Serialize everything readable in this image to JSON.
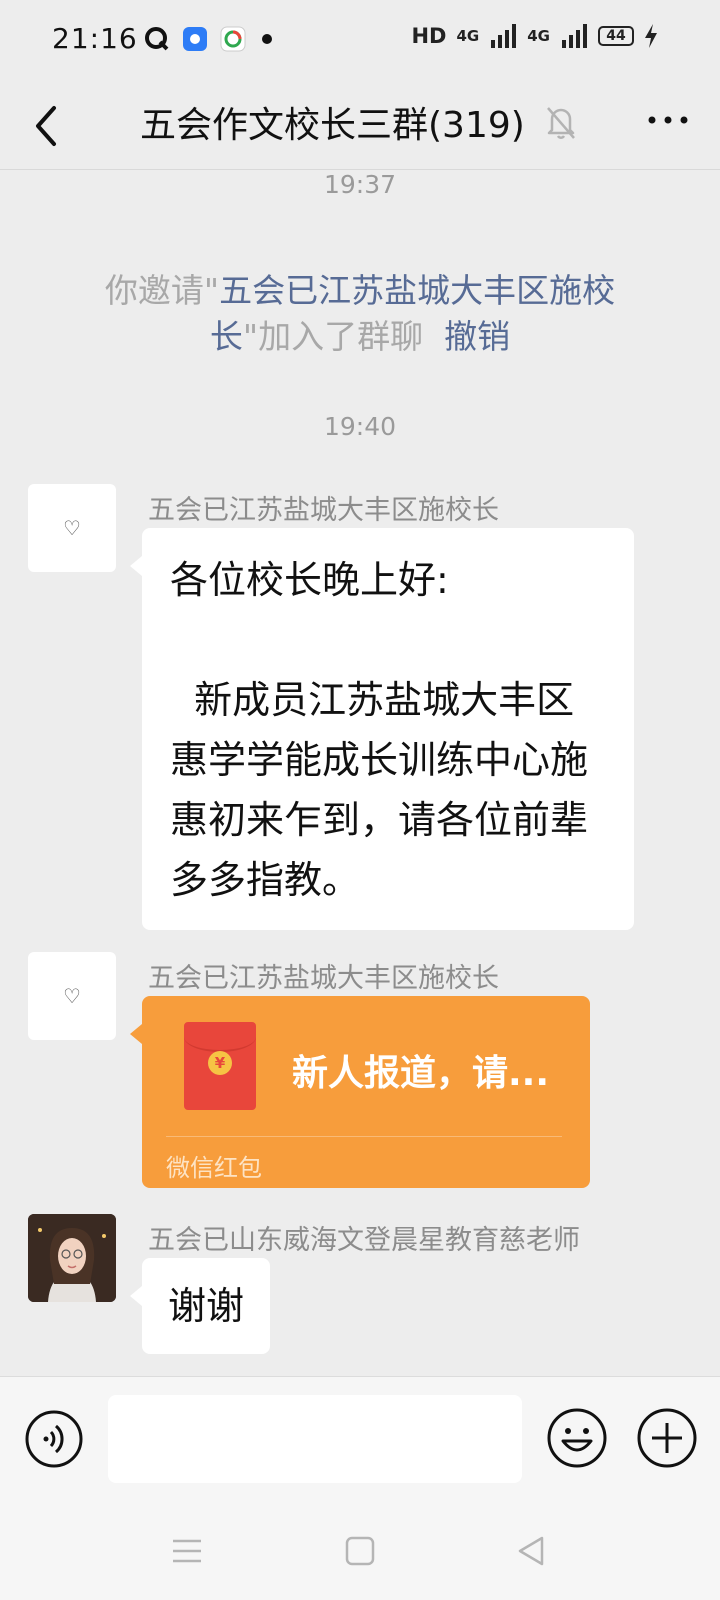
{
  "status_bar": {
    "time": "21:16",
    "hd": "HD",
    "net1": "4G",
    "net2": "4G",
    "battery": "44"
  },
  "nav": {
    "title": "五会作文校长三群(319)"
  },
  "messages": {
    "time1": "19:37",
    "system": {
      "prefix": "你邀请\"",
      "name": "五会已江苏盐城大丰区施校长",
      "suffix": "\"加入了群聊",
      "revoke": "撤销"
    },
    "time2": "19:40",
    "msg1": {
      "avatar": "♡",
      "sender": "五会已江苏盐城大丰区施校长",
      "text": "各位校长晚上好:\n\n  新成员江苏盐城大丰区惠学学能成长训练中心施惠初来乍到，请各位前辈多多指教。"
    },
    "msg2": {
      "avatar": "♡",
      "sender": "五会已江苏盐城大丰区施校长",
      "red_packet_title": "新人报道，请...",
      "red_packet_label": "微信红包",
      "red_packet_symbol": "¥"
    },
    "msg3": {
      "sender": "五会已山东威海文登晨星教育慈老师",
      "text": "谢谢"
    }
  },
  "input": {
    "value": "",
    "placeholder": ""
  },
  "colors": {
    "background": "#ededed",
    "link": "#576b95",
    "red_packet": "#f79d3c",
    "red_envelope": "#e8463b"
  }
}
